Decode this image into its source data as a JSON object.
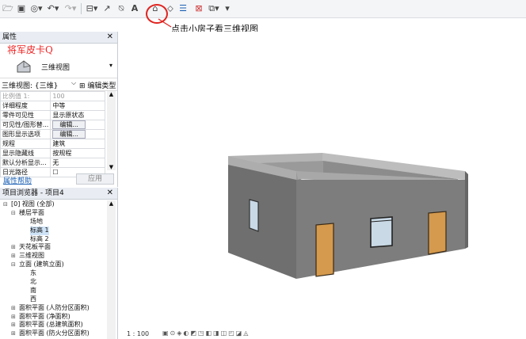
{
  "toolbar": {
    "icons": [
      "open-icon",
      "save-icon",
      "sync-icon",
      "undo-icon",
      "redo-icon",
      "measure-icon",
      "dimension-icon",
      "tag-icon",
      "text-icon",
      "3d-view-icon",
      "section-icon",
      "thin-lines-icon",
      "close-windows-icon",
      "switch-windows-icon",
      "customize-icon"
    ],
    "text_tool": "A"
  },
  "annotation": {
    "text": "点击小房子看三维视图",
    "color": "#e0241f"
  },
  "properties": {
    "title": "属性",
    "watermark": "将军皮卡Q",
    "type_name": "三维视图",
    "filter_label": "三维视图: {三维}",
    "edit_type": "编辑类型",
    "rows": [
      {
        "key": "比例值 1:",
        "value": "100",
        "muted": true
      },
      {
        "key": "详细程度",
        "value": "中等"
      },
      {
        "key": "零件可见性",
        "value": "显示原状态"
      },
      {
        "key": "可见性/图形替...",
        "value": "编辑...",
        "button": true
      },
      {
        "key": "图形显示选项",
        "value": "编辑...",
        "button": true
      },
      {
        "key": "规程",
        "value": "建筑"
      },
      {
        "key": "显示隐藏线",
        "value": "按规程"
      },
      {
        "key": "默认分析显示...",
        "value": "无"
      },
      {
        "key": "日光路径",
        "value": "☐"
      }
    ],
    "help_link": "属性帮助",
    "apply": "应用"
  },
  "project_browser": {
    "title": "项目浏览器 - 项目4",
    "items": [
      {
        "level": 0,
        "expander": "⊟",
        "label": "[0] 视图 (全部)"
      },
      {
        "level": 1,
        "expander": "⊟",
        "label": "楼层平面"
      },
      {
        "level": 2,
        "expander": "",
        "label": "场地"
      },
      {
        "level": 2,
        "expander": "",
        "label": "标高 1",
        "selected": true
      },
      {
        "level": 2,
        "expander": "",
        "label": "标高 2"
      },
      {
        "level": 1,
        "expander": "⊞",
        "label": "天花板平面"
      },
      {
        "level": 1,
        "expander": "⊞",
        "label": "三维视图"
      },
      {
        "level": 1,
        "expander": "⊟",
        "label": "立面 (建筑立面)"
      },
      {
        "level": 2,
        "expander": "",
        "label": "东"
      },
      {
        "level": 2,
        "expander": "",
        "label": "北"
      },
      {
        "level": 2,
        "expander": "",
        "label": "南"
      },
      {
        "level": 2,
        "expander": "",
        "label": "西"
      },
      {
        "level": 1,
        "expander": "⊞",
        "label": "面积平面 (人防分区面积)"
      },
      {
        "level": 1,
        "expander": "⊞",
        "label": "面积平面 (净面积)"
      },
      {
        "level": 1,
        "expander": "⊞",
        "label": "面积平面 (总建筑面积)"
      },
      {
        "level": 1,
        "expander": "⊞",
        "label": "面积平面 (防火分区面积)"
      }
    ]
  },
  "status": {
    "scale": "1 : 100"
  },
  "colors": {
    "wall": "#7d7d7d",
    "door": "#d59a4d",
    "window_glass": "#c9d9e6"
  }
}
